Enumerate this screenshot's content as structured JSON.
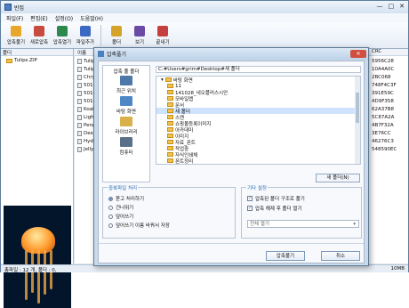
{
  "window": {
    "title": "반집",
    "controls": [
      "—",
      "□",
      "✕"
    ]
  },
  "menu": [
    "파일(F)",
    "편집(E)",
    "설정(O)",
    "도움말(H)"
  ],
  "toolbar": [
    {
      "label": "압축풀기",
      "icon": "folder-extract-icon",
      "color": "#e8a62b"
    },
    {
      "label": "새로압축",
      "icon": "new-archive-icon",
      "color": "#c84b3f"
    },
    {
      "label": "압축열기",
      "icon": "open-archive-icon",
      "color": "#2b8a4b"
    },
    {
      "label": "파일추가",
      "icon": "add-file-icon",
      "color": "#3b69c1"
    },
    {
      "label": "폴더",
      "icon": "folder-icon",
      "color": "#d6a32a"
    },
    {
      "label": "보기",
      "icon": "view-icon",
      "color": "#6b4aa6"
    },
    {
      "label": "끝내기",
      "icon": "exit-icon",
      "color": "#c63f3f"
    }
  ],
  "folder_pane": {
    "title": "폴더",
    "items": [
      {
        "label": "Tulips.ZIP",
        "icon": "folder-icon"
      }
    ]
  },
  "file_list": {
    "headers": [
      "이름",
      "CRC"
    ],
    "rows": [
      {
        "name": "Tulips",
        "crc": "5956C28"
      },
      {
        "name": "Tulip",
        "crc": "10A4A0C"
      },
      {
        "name": "Chrys",
        "crc": "2BC068"
      },
      {
        "name": "50103",
        "crc": "748F4C3F"
      },
      {
        "name": "50105",
        "crc": "391E59C"
      },
      {
        "name": "50103",
        "crc": "4D9F358"
      },
      {
        "name": "Koala",
        "crc": "62A37B8"
      },
      {
        "name": "Lighth",
        "crc": "5C87A2A"
      },
      {
        "name": "Peng",
        "crc": "4B7F32A"
      },
      {
        "name": "Deser",
        "crc": "3E76CC"
      },
      {
        "name": "Hydra",
        "crc": "46276C3"
      },
      {
        "name": "Jellyfi",
        "crc": "548590EC"
      }
    ]
  },
  "statusbar": {
    "left": "총파일 : 12 개, 폴더 : 0,",
    "right": "10MB"
  },
  "dialog": {
    "title": "압축풀기",
    "close": "✕",
    "places": {
      "title": "압축 풀 폴더",
      "items": [
        {
          "label": "최근 위치",
          "icon": "recent-icon",
          "color": "#4e78a8"
        },
        {
          "label": "바탕 화면",
          "icon": "desktop-icon",
          "color": "#4f87c6"
        },
        {
          "label": "라이브러리",
          "icon": "library-icon",
          "color": "#d9b04b"
        },
        {
          "label": "컴퓨터",
          "icon": "computer-icon",
          "color": "#5a7088"
        }
      ]
    },
    "path": "C:#Users#grim#Desktop#새 폴더",
    "tree": [
      {
        "label": "바탕 화면",
        "indent": 1
      },
      {
        "label": "11",
        "indent": 2
      },
      {
        "label": "141028_네오플러스시안",
        "indent": 2
      },
      {
        "label": "모바일랩",
        "indent": 2
      },
      {
        "label": "문서",
        "indent": 2
      },
      {
        "label": "새 폴더",
        "indent": 2,
        "selected": true
      },
      {
        "label": "스캔",
        "indent": 2
      },
      {
        "label": "쇼핑몰등록이미지",
        "indent": 2
      },
      {
        "label": "아카데미",
        "indent": 2
      },
      {
        "label": "이미지",
        "indent": 2
      },
      {
        "label": "자료_폰트",
        "indent": 2
      },
      {
        "label": "작업중",
        "indent": 2
      },
      {
        "label": "자식인쇄체",
        "indent": 2
      },
      {
        "label": "폰트정리",
        "indent": 2
      }
    ],
    "new_folder": "새 폴더(N)",
    "duplicate": {
      "title": "중복파일 처리",
      "options": [
        "묻고 처리하기",
        "건너뛰기",
        "덮어쓰기",
        "덮어쓰기 이름 바꿔서 저장"
      ],
      "selected": 0
    },
    "other": {
      "title": "기타 설정",
      "checks": [
        "압축된 폴더 구조로 풀기",
        "압축 해제 후 폴더 열기"
      ],
      "select": "전체 열기"
    },
    "buttons": {
      "ok": "압축풀기",
      "cancel": "취소"
    }
  }
}
